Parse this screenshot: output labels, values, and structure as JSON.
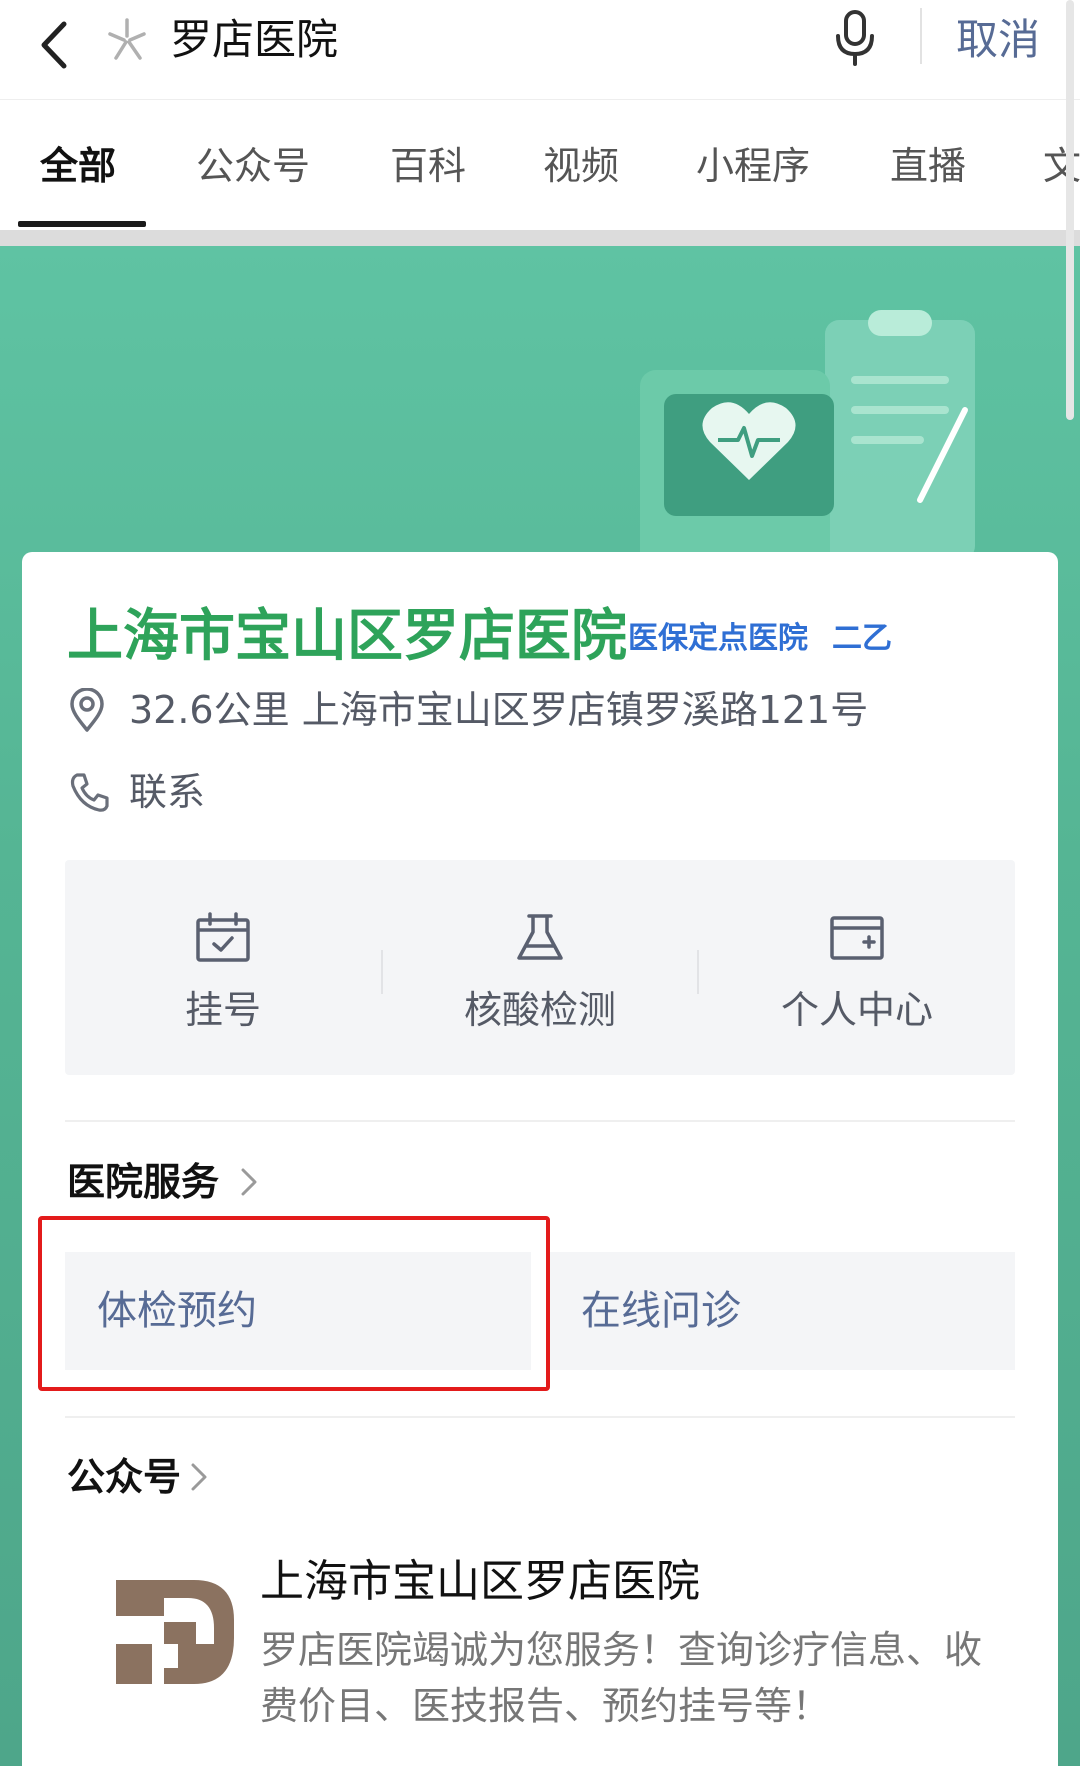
{
  "search": {
    "query": "罗店医院",
    "cancel_label": "取消"
  },
  "tabs": [
    {
      "label": "全部",
      "active": true
    },
    {
      "label": "公众号",
      "active": false
    },
    {
      "label": "百科",
      "active": false
    },
    {
      "label": "视频",
      "active": false
    },
    {
      "label": "小程序",
      "active": false
    },
    {
      "label": "直播",
      "active": false
    },
    {
      "label": "文",
      "active": false
    }
  ],
  "hospital": {
    "name": "上海市宝山区罗店医院",
    "tag_insurance": "医保定点医院",
    "tag_level": "二乙",
    "distance_address": "32.6公里 上海市宝山区罗店镇罗溪路121号",
    "contact_label": "联系"
  },
  "quick_actions": [
    {
      "label": "挂号",
      "icon": "calendar-icon"
    },
    {
      "label": "核酸检测",
      "icon": "flask-icon"
    },
    {
      "label": "个人中心",
      "icon": "id-card-icon"
    }
  ],
  "services": {
    "title": "医院服务",
    "items": [
      "体检预约",
      "在线问诊"
    ]
  },
  "official_account": {
    "section_title": "公众号",
    "name": "上海市宝山区罗店医院",
    "description": "罗店医院竭诚为您服务！查询诊疗信息、收费价目、医技报告、预约挂号等！"
  },
  "colors": {
    "hero_green": "#5fc3a3",
    "hospital_name_green": "#2ea35a",
    "tag_blue": "#2f6fd4",
    "link_blue": "#576b95",
    "highlight_red": "#e31b1b",
    "logo_brown": "#8b7260"
  }
}
